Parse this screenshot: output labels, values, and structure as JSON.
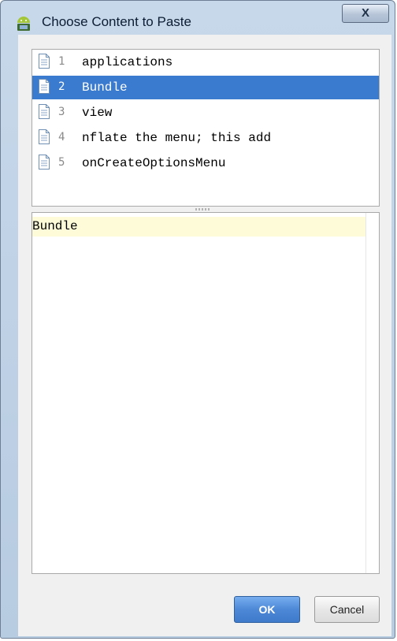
{
  "dialog": {
    "title": "Choose Content to Paste",
    "close_label": "X"
  },
  "clipboard_list": {
    "items": [
      {
        "number": "1",
        "text": "applications",
        "selected": false
      },
      {
        "number": "2",
        "text": "Bundle",
        "selected": true
      },
      {
        "number": "3",
        "text": "view",
        "selected": false
      },
      {
        "number": "4",
        "text": "nflate the menu; this add",
        "selected": false
      },
      {
        "number": "5",
        "text": "onCreateOptionsMenu",
        "selected": false
      }
    ]
  },
  "preview": {
    "text": "Bundle"
  },
  "buttons": {
    "ok_label": "OK",
    "cancel_label": "Cancel"
  },
  "icons": {
    "app": "android-icon",
    "row": "document-icon",
    "close": "close-icon"
  },
  "colors": {
    "selection": "#3a7acf",
    "ok_button": "#4c88d6",
    "preview_highlight": "#fdfbd8",
    "title_bar": "#c7d8ea"
  }
}
